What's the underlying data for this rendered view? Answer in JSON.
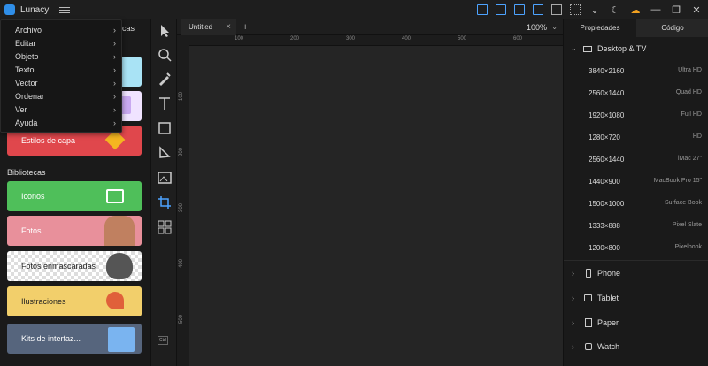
{
  "titlebar": {
    "app_name": "Lunacy"
  },
  "left": {
    "partial_text": "cas",
    "layer_styles": "Estilos de capa",
    "libraries_title": "Bibliotecas",
    "cards": {
      "icons": "Iconos",
      "photos": "Fotos",
      "masked": "Fotos enmascaradas",
      "illustrations": "Ilustraciones",
      "ui_kits": "Kits de interfaz..."
    }
  },
  "menu": {
    "items": [
      "Archivo",
      "Editar",
      "Objeto",
      "Texto",
      "Vector",
      "Ordenar",
      "Ver",
      "Ayuda"
    ],
    "chevron": "›"
  },
  "tabs": {
    "doc": "Untitled",
    "close": "×",
    "add": "+"
  },
  "zoom": {
    "value": "100%"
  },
  "ruler": {
    "h": [
      "100",
      "200",
      "300",
      "400",
      "500",
      "600"
    ],
    "v": [
      "100",
      "200",
      "300",
      "400",
      "500"
    ]
  },
  "toolbar": {
    "ctrl": "Ctrl"
  },
  "right": {
    "tab_properties": "Propiedades",
    "tab_code": "Código",
    "section_desktop": "Desktop & TV",
    "presets": [
      {
        "size": "3840×2160",
        "name": "Ultra HD"
      },
      {
        "size": "2560×1440",
        "name": "Quad HD"
      },
      {
        "size": "1920×1080",
        "name": "Full HD"
      },
      {
        "size": "1280×720",
        "name": "HD"
      },
      {
        "size": "2560×1440",
        "name": "iMac 27\""
      },
      {
        "size": "1440×900",
        "name": "MacBook Pro 15\""
      },
      {
        "size": "1500×1000",
        "name": "Surface Book"
      },
      {
        "size": "1333×888",
        "name": "Pixel Slate"
      },
      {
        "size": "1200×800",
        "name": "Pixelbook"
      }
    ],
    "groups": [
      "Phone",
      "Tablet",
      "Paper",
      "Watch"
    ]
  },
  "colors": {
    "accent": "#2f8ee8",
    "layer_styles_card": "#e0474c",
    "icons_card": "#4fbf5a",
    "photos_card": "#e8909b",
    "illustrations_card": "#f2cf6b",
    "ui_kits_card": "#56657d"
  }
}
